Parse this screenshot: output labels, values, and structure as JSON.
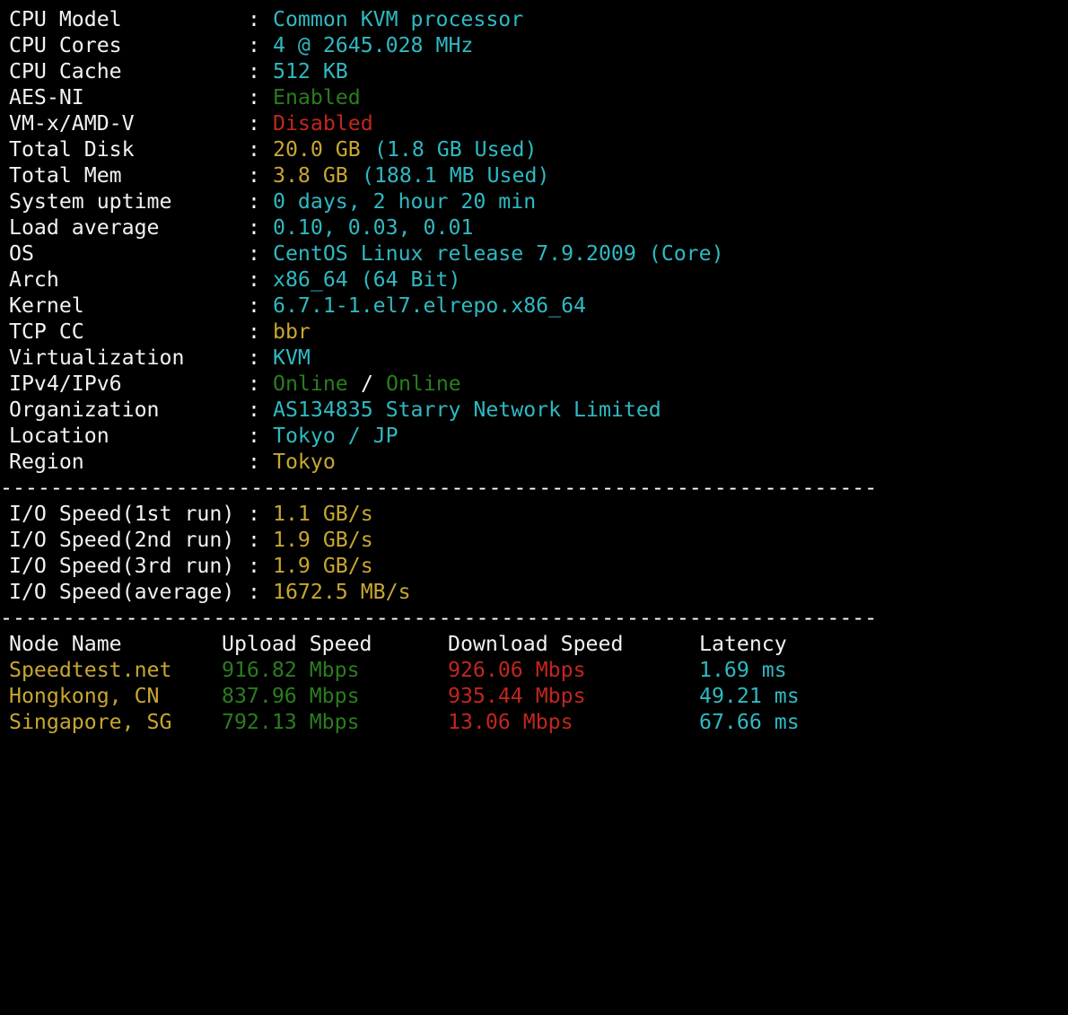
{
  "colors": {
    "background": "#000000",
    "label": "#f2f2f2",
    "cyan": "#2fb9c2",
    "yellow": "#c8a72f",
    "green": "#2a7d1e",
    "red": "#c2261f"
  },
  "system_info": {
    "cpu_model": {
      "label": "CPU Model",
      "value": "Common KVM processor"
    },
    "cpu_cores": {
      "label": "CPU Cores",
      "value": "4 @ 2645.028 MHz"
    },
    "cpu_cache": {
      "label": "CPU Cache",
      "value": "512 KB"
    },
    "aes_ni": {
      "label": "AES-NI",
      "value": "Enabled"
    },
    "vmx": {
      "label": "VM-x/AMD-V",
      "value": "Disabled"
    },
    "total_disk": {
      "label": "Total Disk",
      "value": "20.0 GB",
      "used": "(1.8 GB Used)"
    },
    "total_mem": {
      "label": "Total Mem",
      "value": "3.8 GB",
      "used": "(188.1 MB Used)"
    },
    "uptime": {
      "label": "System uptime",
      "value": "0 days, 2 hour 20 min"
    },
    "load": {
      "label": "Load average",
      "value": "0.10, 0.03, 0.01"
    },
    "os": {
      "label": "OS",
      "value": "CentOS Linux release 7.9.2009 (Core)"
    },
    "arch": {
      "label": "Arch",
      "value": "x86_64 (64 Bit)"
    },
    "kernel": {
      "label": "Kernel",
      "value": "6.7.1-1.el7.elrepo.x86_64"
    },
    "tcp_cc": {
      "label": "TCP CC",
      "value": "bbr"
    },
    "virtualization": {
      "label": "Virtualization",
      "value": "KVM"
    },
    "ip": {
      "label": "IPv4/IPv6",
      "v4": "Online",
      "slash": "/",
      "v6": "Online"
    },
    "organization": {
      "label": "Organization",
      "value": "AS134835 Starry Network Limited"
    },
    "location": {
      "label": "Location",
      "value": "Tokyo / JP"
    },
    "region": {
      "label": "Region",
      "value": "Tokyo"
    }
  },
  "colon": ":",
  "separator": "----------------------------------------------------------------------",
  "io_speed": {
    "run1": {
      "label": "I/O Speed(1st run)",
      "value": "1.1 GB/s"
    },
    "run2": {
      "label": "I/O Speed(2nd run)",
      "value": "1.9 GB/s"
    },
    "run3": {
      "label": "I/O Speed(3rd run)",
      "value": "1.9 GB/s"
    },
    "average": {
      "label": "I/O Speed(average)",
      "value": "1672.5 MB/s"
    }
  },
  "speedtest": {
    "headers": {
      "node": "Node Name",
      "upload": "Upload Speed",
      "download": "Download Speed",
      "latency": "Latency"
    },
    "rows": [
      {
        "node": "Speedtest.net",
        "upload": "916.82 Mbps",
        "download": "926.06 Mbps",
        "latency": "1.69 ms"
      },
      {
        "node": "Hongkong, CN",
        "upload": "837.96 Mbps",
        "download": "935.44 Mbps",
        "latency": "49.21 ms"
      },
      {
        "node": "Singapore, SG",
        "upload": "792.13 Mbps",
        "download": "13.06 Mbps",
        "latency": "67.66 ms"
      }
    ]
  }
}
